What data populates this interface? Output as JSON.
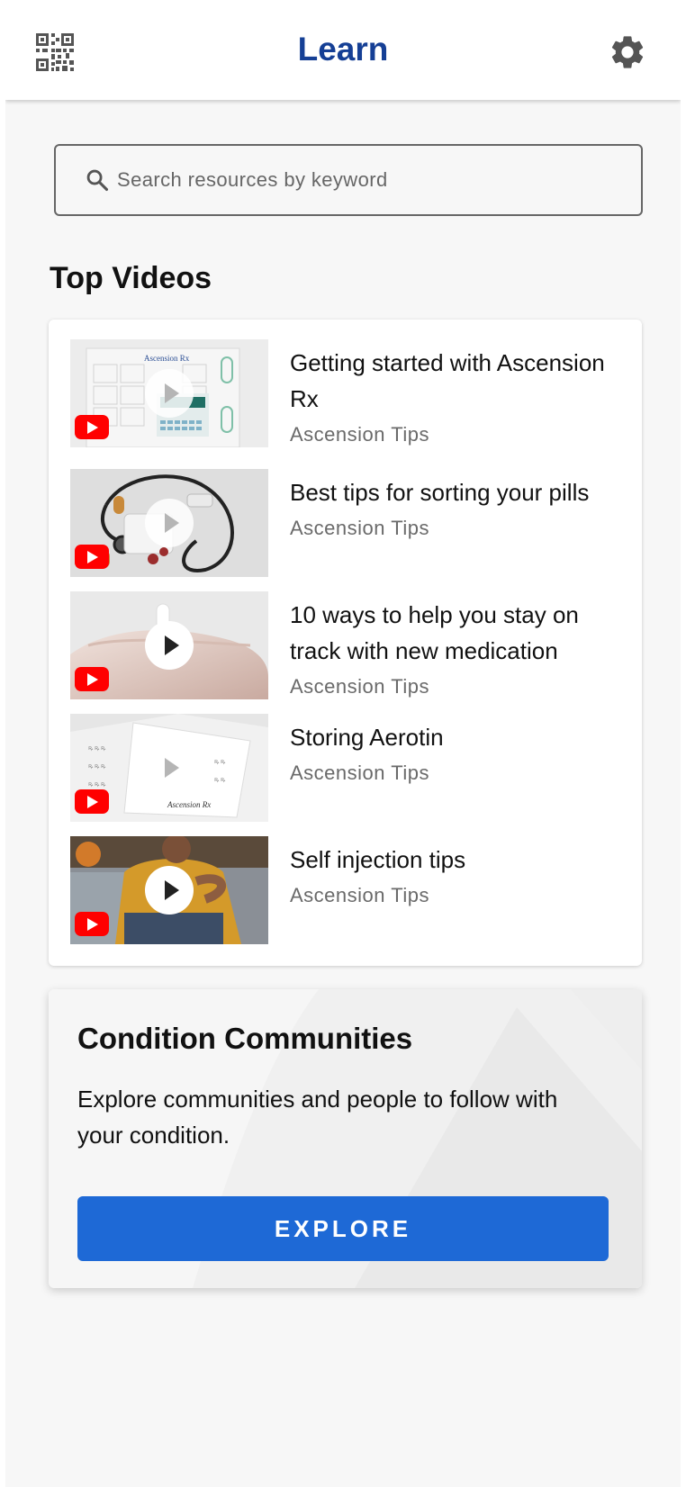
{
  "header": {
    "title": "Learn",
    "left_icon": "qr-code-icon",
    "right_icon": "gear-icon"
  },
  "search": {
    "placeholder": "Search resources by keyword",
    "icon": "search-icon"
  },
  "top_videos": {
    "title": "Top Videos",
    "items": [
      {
        "title": "Getting started with Ascension Rx",
        "channel": "Ascension Tips",
        "thumbnail_brand_text": "Ascension Rx"
      },
      {
        "title": "Best tips for sorting your pills",
        "channel": "Ascension Tips"
      },
      {
        "title": "10 ways to help you stay on track with new medication",
        "channel": "Ascension Tips"
      },
      {
        "title": "Storing Aerotin",
        "channel": "Ascension Tips",
        "thumbnail_brand_text": "Ascension Rx"
      },
      {
        "title": "Self injection tips",
        "channel": "Ascension Tips"
      }
    ]
  },
  "communities": {
    "title": "Condition Communities",
    "description": "Explore communities and people to follow with your condition.",
    "button_label": "EXPLORE"
  },
  "colors": {
    "title_blue": "#153f95",
    "button_blue": "#1e69d6",
    "youtube_red": "#ff0000"
  }
}
